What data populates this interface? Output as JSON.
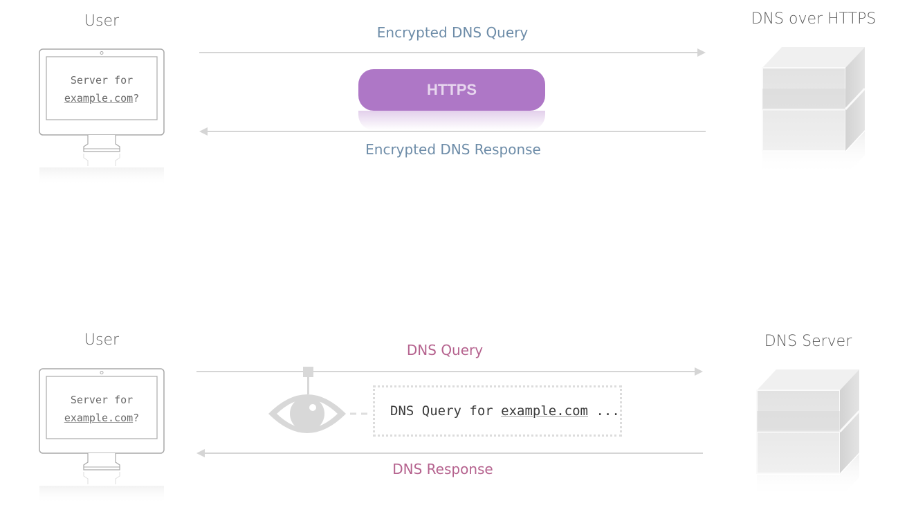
{
  "top_diagram": {
    "user_label": "User",
    "server_label": "DNS over HTTPS",
    "query_label": "Encrypted DNS Query",
    "response_label": "Encrypted DNS Response",
    "channel_label": "HTTPS",
    "screen_line1": "Server for",
    "screen_domain": "example.com",
    "screen_suffix": "?"
  },
  "bottom_diagram": {
    "user_label": "User",
    "server_label": "DNS Server",
    "query_label": "DNS Query",
    "response_label": "DNS Response",
    "screen_line1": "Server for",
    "screen_domain": "example.com",
    "screen_suffix": "?",
    "intercept_prefix": "DNS Query for ",
    "intercept_domain": "example.com",
    "intercept_suffix": " ..."
  },
  "colors": {
    "https_pill": "#ae77c6",
    "doh_text": "#6d8ca8",
    "plain_text": "#b5628e",
    "arrow": "#d5d5d5"
  },
  "icons": {
    "user_device": "desktop-monitor-icon",
    "server": "server-cube-icon",
    "eavesdropper": "eye-icon"
  }
}
